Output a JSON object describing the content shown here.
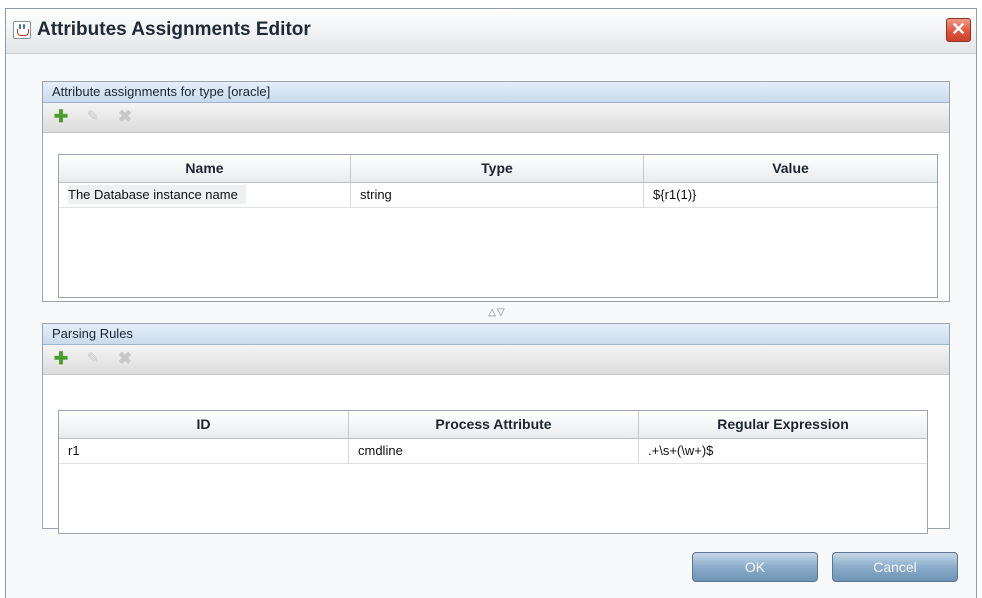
{
  "window": {
    "title": "Attributes Assignments Editor",
    "close_glyph": "✕",
    "icon": "java-app-icon"
  },
  "assignments": {
    "header": "Attribute assignments for type [oracle]",
    "toolbar": {
      "add_glyph": "✚",
      "edit_glyph": "✎",
      "delete_glyph": "✖",
      "add_icon": "add-icon",
      "edit_icon": "edit-icon",
      "delete_icon": "delete-icon"
    },
    "columns": [
      "Name",
      "Type",
      "Value"
    ],
    "rows": [
      [
        "The Database instance name",
        "string",
        "${r1(1)}"
      ]
    ]
  },
  "splitter": {
    "glyph": "△▽"
  },
  "parsing": {
    "header": "Parsing Rules",
    "toolbar": {
      "add_glyph": "✚",
      "edit_glyph": "✎",
      "delete_glyph": "✖",
      "add_icon": "add-icon",
      "edit_icon": "edit-icon",
      "delete_icon": "delete-icon"
    },
    "columns": [
      "ID",
      "Process Attribute",
      "Regular Expression"
    ],
    "rows": [
      [
        "r1",
        "cmdline",
        ".+\\s+(\\w+)$"
      ]
    ]
  },
  "buttons": {
    "ok": "OK",
    "cancel": "Cancel"
  },
  "colors": {
    "accent": "#6d92b4",
    "close": "#e2553c",
    "add_green": "#4c9e2c",
    "header_blue": "#c9dbee"
  }
}
